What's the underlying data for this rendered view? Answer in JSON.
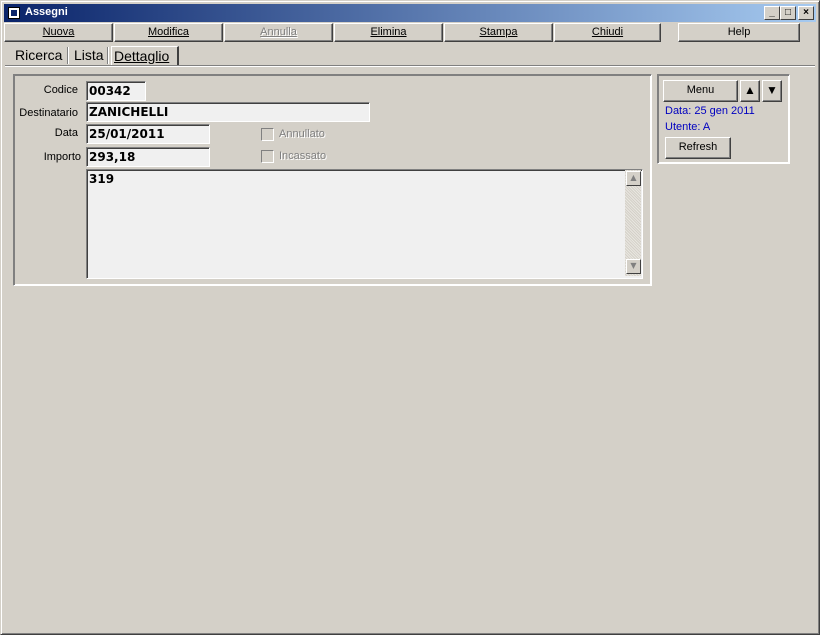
{
  "window": {
    "title": "Assegni",
    "minimize": "_",
    "maximize": "□",
    "close": "×"
  },
  "toolbar": {
    "nuova": "Nuova",
    "modifica": "Modifica",
    "annulla": "Annulla",
    "elimina": "Elimina",
    "stampa": "Stampa",
    "chiudi": "Chiudi",
    "help": "Help"
  },
  "tabs": {
    "ricerca": "Ricerca",
    "lista": "Lista",
    "dettaglio": "Dettaglio"
  },
  "form": {
    "codice_label": "Codice",
    "codice_value": "00342",
    "destinatario_label": "Destinatario",
    "destinatario_value": "ZANICHELLI",
    "data_label": "Data",
    "data_value": "25/01/2011",
    "importo_label": "Importo",
    "importo_value": "293,18",
    "annullato_label": "Annullato",
    "incassato_label": "Incassato",
    "note_value": "319"
  },
  "side_panel": {
    "menu_label": "Menu",
    "data_info": "Data: 25 gen 2011",
    "utente_info": "Utente: A",
    "refresh_label": "Refresh"
  }
}
